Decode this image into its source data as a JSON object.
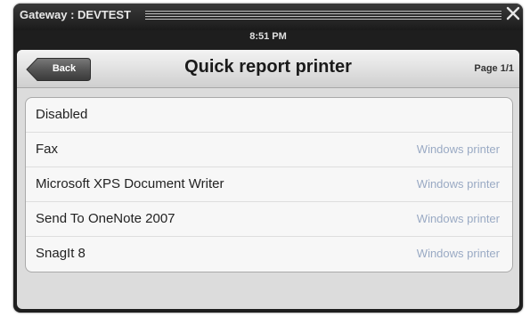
{
  "window": {
    "title": "Gateway : DEVTEST",
    "time": "8:51 PM",
    "close_icon": "close-icon"
  },
  "navbar": {
    "back_label": "Back",
    "title": "Quick report printer",
    "page_indicator": "Page 1/1"
  },
  "printers": [
    {
      "name": "Disabled",
      "type": ""
    },
    {
      "name": "Fax",
      "type": "Windows printer"
    },
    {
      "name": "Microsoft XPS Document Writer",
      "type": "Windows printer"
    },
    {
      "name": "Send To OneNote 2007",
      "type": "Windows printer"
    },
    {
      "name": "SnagIt 8",
      "type": "Windows printer"
    }
  ],
  "colors": {
    "title_bar": "#1e1e1e",
    "secondary_text": "#9aaac4",
    "back_button": "#4a4a4a"
  }
}
